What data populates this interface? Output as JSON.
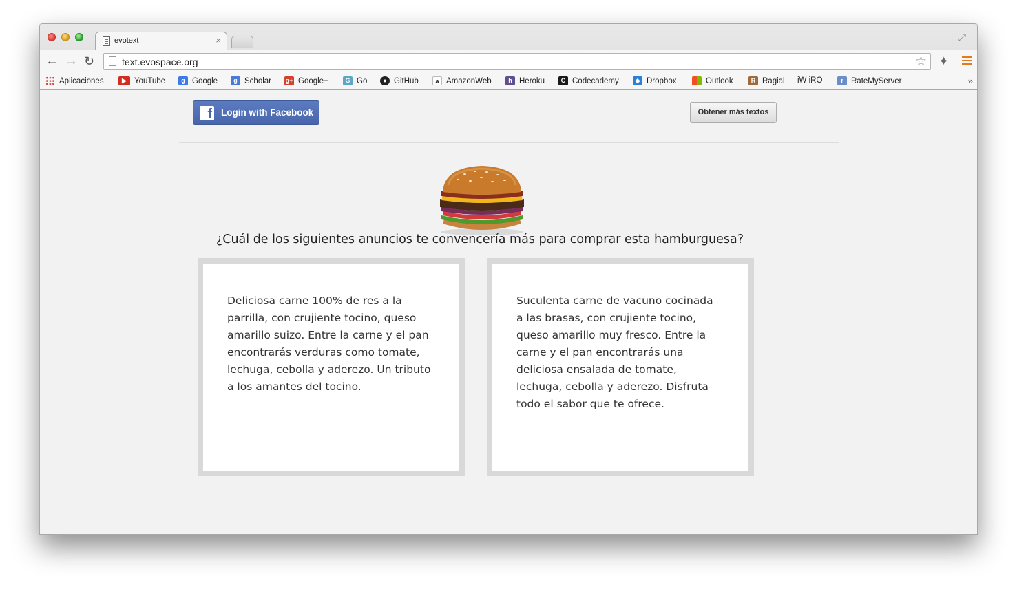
{
  "browser": {
    "tab_title": "evotext",
    "tab_close": "×",
    "url": "text.evospace.org",
    "fullscreen": "⤢",
    "back": "←",
    "forward": "→",
    "reload": "↻",
    "star": "☆",
    "extension": "✦",
    "bookmarks": [
      {
        "label": "Aplicaciones",
        "icon": "apps-grid-icon",
        "color": "#d0463b"
      },
      {
        "label": "YouTube",
        "icon": "youtube-icon",
        "color": "#d42c1f"
      },
      {
        "label": "Google",
        "icon": "google-icon",
        "color": "#3f7be7"
      },
      {
        "label": "Scholar",
        "icon": "scholar-icon",
        "color": "#4a7ad6"
      },
      {
        "label": "Google+",
        "icon": "google-plus-icon",
        "color": "#d5412f"
      },
      {
        "label": "Go",
        "icon": "go-icon",
        "color": "#5aa7c8"
      },
      {
        "label": "GitHub",
        "icon": "github-icon",
        "color": "#222222"
      },
      {
        "label": "AmazonWeb",
        "icon": "amazon-icon",
        "color": "#ffffff"
      },
      {
        "label": "Heroku",
        "icon": "heroku-icon",
        "color": "#5f4f8f"
      },
      {
        "label": "Codecademy",
        "icon": "codecademy-icon",
        "color": "#1a1a1a"
      },
      {
        "label": "Dropbox",
        "icon": "dropbox-icon",
        "color": "#2d80d8"
      },
      {
        "label": "Outlook",
        "icon": "outlook-icon",
        "color": "#f25022"
      },
      {
        "label": "Ragial",
        "icon": "ragial-icon",
        "color": "#a06a3a"
      },
      {
        "label": "iW iRO",
        "icon": "",
        "color": ""
      },
      {
        "label": "RateMyServer",
        "icon": "ratemyserver-icon",
        "color": "#6a8fc8"
      }
    ],
    "bookmarks_more": "»"
  },
  "page": {
    "facebook_button": "Login with Facebook",
    "more_texts_button": "Obtener más textos",
    "question": "¿Cuál de los siguientes anuncios te convencería más para comprar esta hamburguesa?",
    "ads": [
      "Deliciosa carne 100% de res  a la parrilla, con crujiente tocino, queso amarillo suizo. Entre la carne y el pan encontrarás verduras como tomate, lechuga, cebolla y aderezo. Un tributo a los amantes del tocino.",
      "Suculenta carne de vacuno  cocinada a las brasas, con crujiente tocino, queso amarillo muy fresco. Entre la carne y el pan encontrarás una deliciosa ensalada de tomate, lechuga, cebolla y aderezo. Disfruta todo el sabor que te ofrece."
    ]
  },
  "colors": {
    "facebook_blue": "#4966ac",
    "menu_orange": "#e07b1f"
  }
}
